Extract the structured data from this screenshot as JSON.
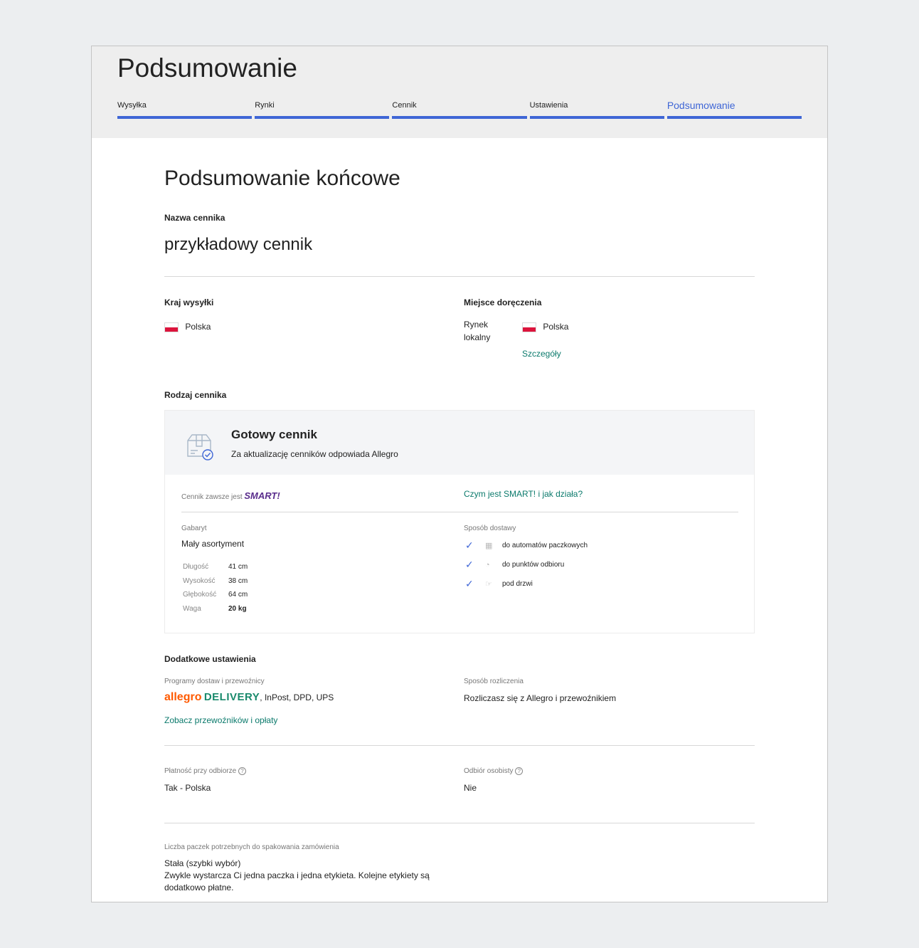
{
  "header": {
    "title": "Podsumowanie",
    "steps": [
      "Wysyłka",
      "Rynki",
      "Cennik",
      "Ustawienia",
      "Podsumowanie"
    ]
  },
  "main": {
    "title": "Podsumowanie końcowe",
    "name_label": "Nazwa cennika",
    "name_value": "przykładowy cennik",
    "ship_country_label": "Kraj wysyłki",
    "ship_country_value": "Polska",
    "delivery_place_label": "Miejsce doręczenia",
    "market_label_1": "Rynek",
    "market_label_2": "lokalny",
    "market_value": "Polska",
    "details_link": "Szczegóły",
    "type_label": "Rodzaj cennika",
    "card": {
      "title": "Gotowy cennik",
      "subtitle": "Za aktualizację cenników odpowiada Allegro",
      "smart_prefix": "Cennik zawsze jest",
      "smart_logo": "SMART!",
      "smart_link": "Czym jest SMART! i jak działa?",
      "size_label": "Gabaryt",
      "size_value": "Mały asortyment",
      "dims": [
        {
          "k": "Długość",
          "v": "41 cm"
        },
        {
          "k": "Wysokość",
          "v": "38 cm"
        },
        {
          "k": "Głębokość",
          "v": "64 cm"
        },
        {
          "k": "Waga",
          "v": "20 kg"
        }
      ],
      "method_label": "Sposób dostawy",
      "methods": [
        "do automatów paczkowych",
        "do punktów odbioru",
        "pod drzwi"
      ]
    },
    "extra_label": "Dodatkowe ustawienia",
    "programs_label": "Programy dostaw i przewoźnicy",
    "allegro_word": "allegro",
    "delivery_word": "DELIVERY",
    "carriers_rest": ", InPost, DPD, UPS",
    "carriers_link": "Zobacz przewoźników i opłaty",
    "settlement_label": "Sposób rozliczenia",
    "settlement_value": "Rozliczasz się z Allegro i przewoźnikiem",
    "cod_label": "Płatność przy odbiorze",
    "cod_value": "Tak - Polska",
    "pickup_label": "Odbiór osobisty",
    "pickup_value": "Nie",
    "parcels_label": "Liczba paczek potrzebnych do spakowania zamówienia",
    "parcels_value_1": "Stała (szybki wybór)",
    "parcels_value_2": "Zwykle wystarcza Ci jedna paczka i jedna etykieta. Kolejne etykiety są",
    "parcels_value_3": "dodatkowo płatne."
  }
}
